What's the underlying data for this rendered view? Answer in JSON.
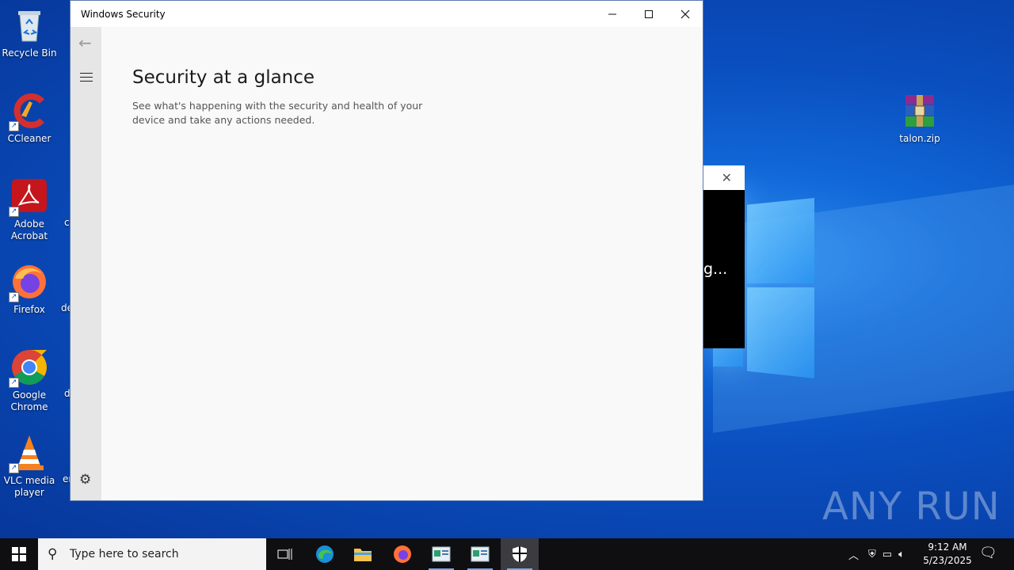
{
  "window": {
    "title": "Windows Security",
    "heading": "Security at a glance",
    "description": "See what's happening with the security and health of your device and take any actions needed."
  },
  "desktop_icons": [
    {
      "label": "Recycle Bin"
    },
    {
      "label": "CCleaner"
    },
    {
      "label": "Adobe Acrobat"
    },
    {
      "label": "Firefox"
    },
    {
      "label": "Google Chrome"
    },
    {
      "label": "VLC media player"
    },
    {
      "label": "talon.zip"
    }
  ],
  "cut_labels": [
    "c",
    "de",
    "d",
    "er"
  ],
  "popup": {
    "text": "g..."
  },
  "watermark": "ANY RUN",
  "taskbar": {
    "search_placeholder": "Type here to search",
    "time": "9:12 AM",
    "date": "5/23/2025"
  }
}
